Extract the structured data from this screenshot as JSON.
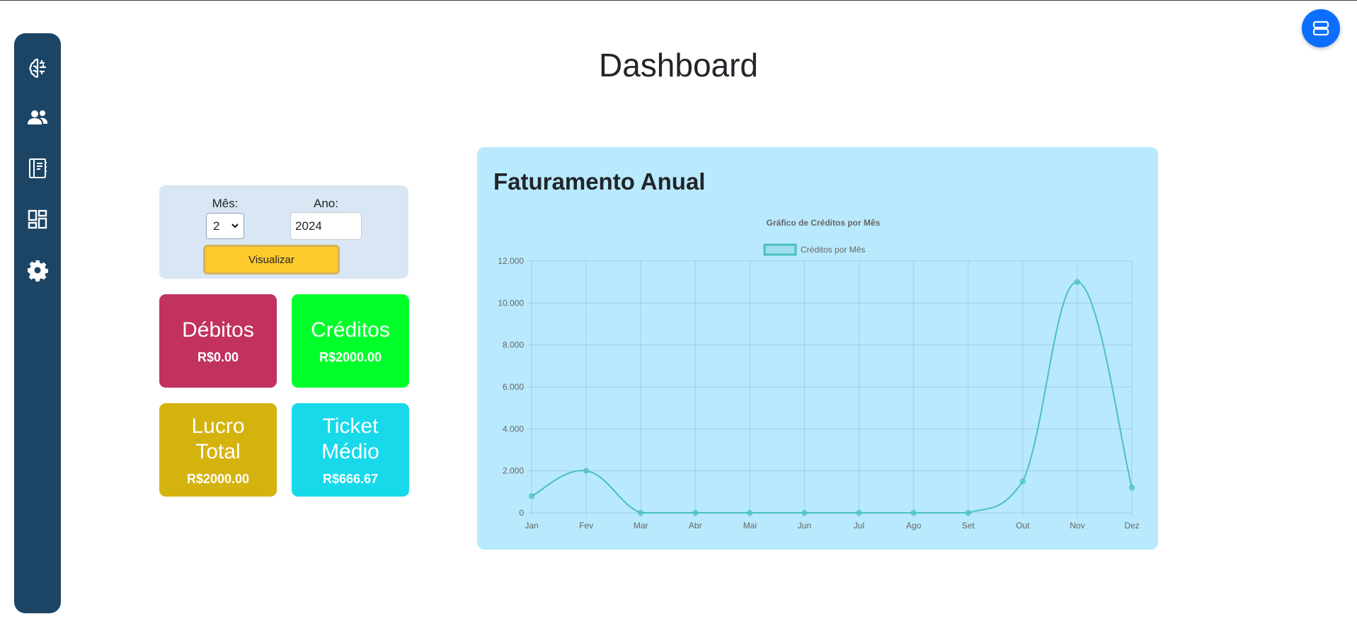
{
  "page": {
    "title": "Dashboard"
  },
  "sidebar": {
    "items": [
      {
        "name": "brain-icon"
      },
      {
        "name": "users-icon"
      },
      {
        "name": "notebook-icon"
      },
      {
        "name": "dashboard-icon"
      },
      {
        "name": "gear-icon"
      }
    ]
  },
  "fab": {
    "icon": "server-icon"
  },
  "filter": {
    "month_label": "Mês:",
    "month_value": "2",
    "year_label": "Ano:",
    "year_value": "2024",
    "button_label": "Visualizar"
  },
  "cards": {
    "debitos": {
      "title": "Débitos",
      "value": "R$0.00",
      "color": "#c2325f"
    },
    "creditos": {
      "title": "Créditos",
      "value": "R$2000.00",
      "color": "#00ff2a"
    },
    "lucro": {
      "title": "Lucro Total",
      "value": "R$2000.00",
      "color": "#d5b30f"
    },
    "ticket": {
      "title": "Ticket Médio",
      "value": "R$666.67",
      "color": "#17d9e9"
    }
  },
  "chart_panel": {
    "title": "Faturamento Anual"
  },
  "chart_data": {
    "type": "line",
    "title": "Gráfico de Créditos por Mês",
    "categories": [
      "Jan",
      "Fev",
      "Mar",
      "Abr",
      "Mai",
      "Jun",
      "Jul",
      "Ago",
      "Set",
      "Out",
      "Nov",
      "Dez"
    ],
    "series": [
      {
        "name": "Créditos por Mês",
        "values": [
          800,
          2000,
          0,
          0,
          0,
          0,
          0,
          0,
          0,
          1500,
          11000,
          1200
        ],
        "color": "#4bc0c0"
      }
    ],
    "ylim": [
      0,
      12000
    ],
    "yticks": [
      "0",
      "2.000",
      "4.000",
      "6.000",
      "8.000",
      "10.000",
      "12.000"
    ],
    "grid": true,
    "legend": "top"
  }
}
